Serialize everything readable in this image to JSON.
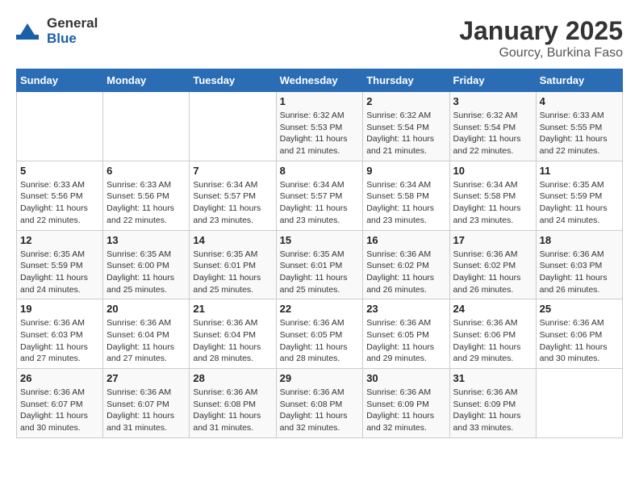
{
  "header": {
    "logo_general": "General",
    "logo_blue": "Blue",
    "month": "January 2025",
    "location": "Gourcy, Burkina Faso"
  },
  "weekdays": [
    "Sunday",
    "Monday",
    "Tuesday",
    "Wednesday",
    "Thursday",
    "Friday",
    "Saturday"
  ],
  "weeks": [
    [
      {
        "day": "",
        "info": ""
      },
      {
        "day": "",
        "info": ""
      },
      {
        "day": "",
        "info": ""
      },
      {
        "day": "1",
        "info": "Sunrise: 6:32 AM\nSunset: 5:53 PM\nDaylight: 11 hours and 21 minutes."
      },
      {
        "day": "2",
        "info": "Sunrise: 6:32 AM\nSunset: 5:54 PM\nDaylight: 11 hours and 21 minutes."
      },
      {
        "day": "3",
        "info": "Sunrise: 6:32 AM\nSunset: 5:54 PM\nDaylight: 11 hours and 22 minutes."
      },
      {
        "day": "4",
        "info": "Sunrise: 6:33 AM\nSunset: 5:55 PM\nDaylight: 11 hours and 22 minutes."
      }
    ],
    [
      {
        "day": "5",
        "info": "Sunrise: 6:33 AM\nSunset: 5:56 PM\nDaylight: 11 hours and 22 minutes."
      },
      {
        "day": "6",
        "info": "Sunrise: 6:33 AM\nSunset: 5:56 PM\nDaylight: 11 hours and 22 minutes."
      },
      {
        "day": "7",
        "info": "Sunrise: 6:34 AM\nSunset: 5:57 PM\nDaylight: 11 hours and 23 minutes."
      },
      {
        "day": "8",
        "info": "Sunrise: 6:34 AM\nSunset: 5:57 PM\nDaylight: 11 hours and 23 minutes."
      },
      {
        "day": "9",
        "info": "Sunrise: 6:34 AM\nSunset: 5:58 PM\nDaylight: 11 hours and 23 minutes."
      },
      {
        "day": "10",
        "info": "Sunrise: 6:34 AM\nSunset: 5:58 PM\nDaylight: 11 hours and 23 minutes."
      },
      {
        "day": "11",
        "info": "Sunrise: 6:35 AM\nSunset: 5:59 PM\nDaylight: 11 hours and 24 minutes."
      }
    ],
    [
      {
        "day": "12",
        "info": "Sunrise: 6:35 AM\nSunset: 5:59 PM\nDaylight: 11 hours and 24 minutes."
      },
      {
        "day": "13",
        "info": "Sunrise: 6:35 AM\nSunset: 6:00 PM\nDaylight: 11 hours and 25 minutes."
      },
      {
        "day": "14",
        "info": "Sunrise: 6:35 AM\nSunset: 6:01 PM\nDaylight: 11 hours and 25 minutes."
      },
      {
        "day": "15",
        "info": "Sunrise: 6:35 AM\nSunset: 6:01 PM\nDaylight: 11 hours and 25 minutes."
      },
      {
        "day": "16",
        "info": "Sunrise: 6:36 AM\nSunset: 6:02 PM\nDaylight: 11 hours and 26 minutes."
      },
      {
        "day": "17",
        "info": "Sunrise: 6:36 AM\nSunset: 6:02 PM\nDaylight: 11 hours and 26 minutes."
      },
      {
        "day": "18",
        "info": "Sunrise: 6:36 AM\nSunset: 6:03 PM\nDaylight: 11 hours and 26 minutes."
      }
    ],
    [
      {
        "day": "19",
        "info": "Sunrise: 6:36 AM\nSunset: 6:03 PM\nDaylight: 11 hours and 27 minutes."
      },
      {
        "day": "20",
        "info": "Sunrise: 6:36 AM\nSunset: 6:04 PM\nDaylight: 11 hours and 27 minutes."
      },
      {
        "day": "21",
        "info": "Sunrise: 6:36 AM\nSunset: 6:04 PM\nDaylight: 11 hours and 28 minutes."
      },
      {
        "day": "22",
        "info": "Sunrise: 6:36 AM\nSunset: 6:05 PM\nDaylight: 11 hours and 28 minutes."
      },
      {
        "day": "23",
        "info": "Sunrise: 6:36 AM\nSunset: 6:05 PM\nDaylight: 11 hours and 29 minutes."
      },
      {
        "day": "24",
        "info": "Sunrise: 6:36 AM\nSunset: 6:06 PM\nDaylight: 11 hours and 29 minutes."
      },
      {
        "day": "25",
        "info": "Sunrise: 6:36 AM\nSunset: 6:06 PM\nDaylight: 11 hours and 30 minutes."
      }
    ],
    [
      {
        "day": "26",
        "info": "Sunrise: 6:36 AM\nSunset: 6:07 PM\nDaylight: 11 hours and 30 minutes."
      },
      {
        "day": "27",
        "info": "Sunrise: 6:36 AM\nSunset: 6:07 PM\nDaylight: 11 hours and 31 minutes."
      },
      {
        "day": "28",
        "info": "Sunrise: 6:36 AM\nSunset: 6:08 PM\nDaylight: 11 hours and 31 minutes."
      },
      {
        "day": "29",
        "info": "Sunrise: 6:36 AM\nSunset: 6:08 PM\nDaylight: 11 hours and 32 minutes."
      },
      {
        "day": "30",
        "info": "Sunrise: 6:36 AM\nSunset: 6:09 PM\nDaylight: 11 hours and 32 minutes."
      },
      {
        "day": "31",
        "info": "Sunrise: 6:36 AM\nSunset: 6:09 PM\nDaylight: 11 hours and 33 minutes."
      },
      {
        "day": "",
        "info": ""
      }
    ]
  ]
}
